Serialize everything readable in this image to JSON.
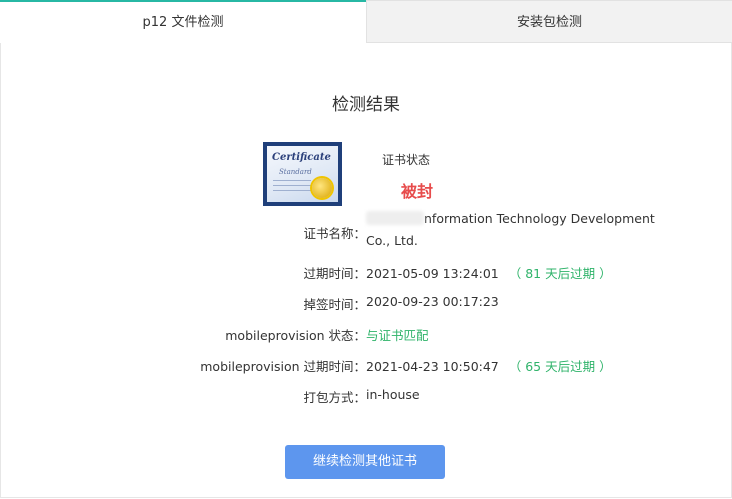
{
  "tabs": [
    {
      "label": "p12 文件检测",
      "active": true
    },
    {
      "label": "安装包检测",
      "active": false
    }
  ],
  "result": {
    "title": "检测结果",
    "cert_status_label": "证书状态",
    "cert_status_value": "被封",
    "fields": {
      "cert_name_label": "证书名称：",
      "cert_name_value_line1": "nformation Technology Development",
      "cert_name_value_line2": "Co., Ltd.",
      "expire_label": "过期时间：",
      "expire_value": "2021-05-09 13:24:01",
      "expire_note": "（ 81 天后过期 ）",
      "revoked_label": "掉签时间：",
      "revoked_value": "2020-09-23 00:17:23",
      "mp_status_label": "mobileprovision 状态：",
      "mp_status_value": "与证书匹配",
      "mp_expire_label": "mobileprovision 过期时间：",
      "mp_expire_value": "2021-04-23 10:50:47",
      "mp_expire_note": "（ 65 天后过期 ）",
      "pack_label": "打包方式：",
      "pack_value": "in-house"
    },
    "continue_button": "继续检测其他证书"
  },
  "colors": {
    "accent": "#27b8a4",
    "revoked": "#e74c4c",
    "ok": "#2fb36a",
    "button": "#5d96ee"
  },
  "icons": {
    "certificate": "certificate-icon"
  }
}
